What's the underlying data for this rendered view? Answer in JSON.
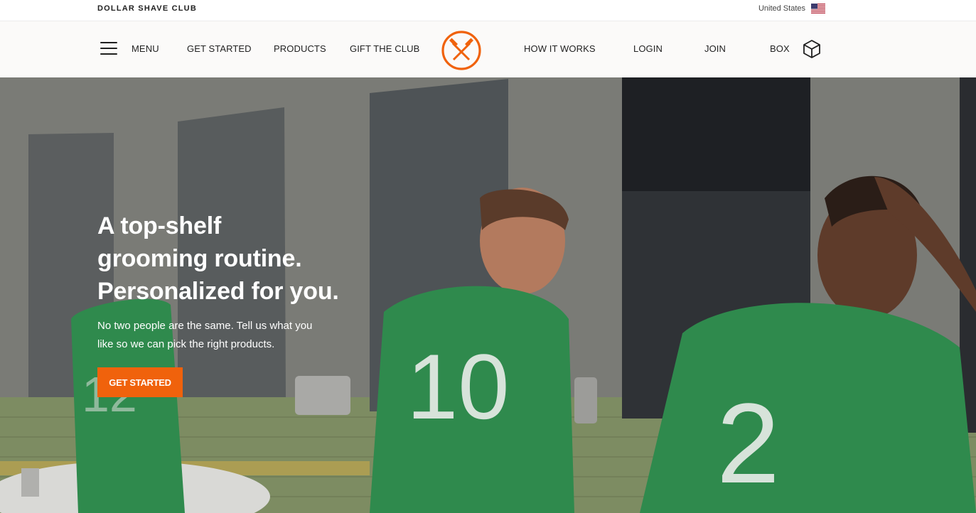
{
  "topbar": {
    "brand": "DOLLAR SHAVE CLUB",
    "locale": "United States",
    "flag_icon": "us-flag-icon"
  },
  "nav": {
    "menu_label": "MENU",
    "menu_icon": "hamburger-icon",
    "left_links": [
      "GET STARTED",
      "PRODUCTS",
      "GIFT THE CLUB"
    ],
    "logo_icon": "crossed-axes-logo-icon",
    "right_links": [
      "HOW IT WORKS",
      "LOGIN",
      "JOIN"
    ],
    "box_label": "BOX",
    "box_icon": "box-cube-icon"
  },
  "colors": {
    "accent": "#f0620c",
    "nav_bg": "#fbfaf9",
    "text": "#222222"
  },
  "hero": {
    "headline_lines": [
      "A top-shelf",
      "grooming routine.",
      "Personalized for you."
    ],
    "subtext": "No two people are the same. Tell us what you like so we can pick the right products.",
    "cta_label": "GET STARTED",
    "jersey_numbers": [
      "12",
      "10",
      "2"
    ]
  }
}
